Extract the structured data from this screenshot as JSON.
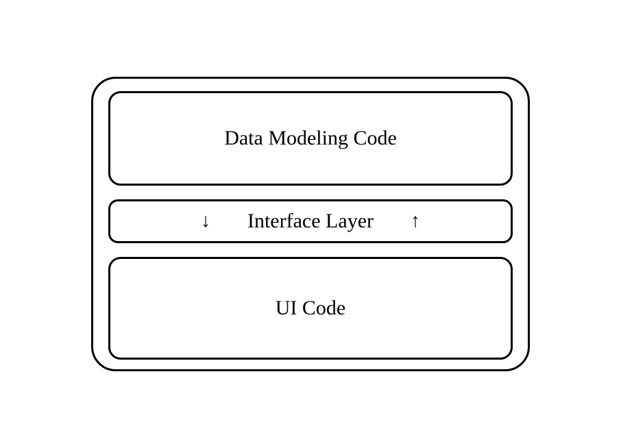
{
  "diagram": {
    "top_box_label": "Data Modeling Code",
    "middle_box_label": "Interface Layer",
    "bottom_box_label": "UI Code",
    "arrows": {
      "down": "↓",
      "up": "↑"
    }
  }
}
